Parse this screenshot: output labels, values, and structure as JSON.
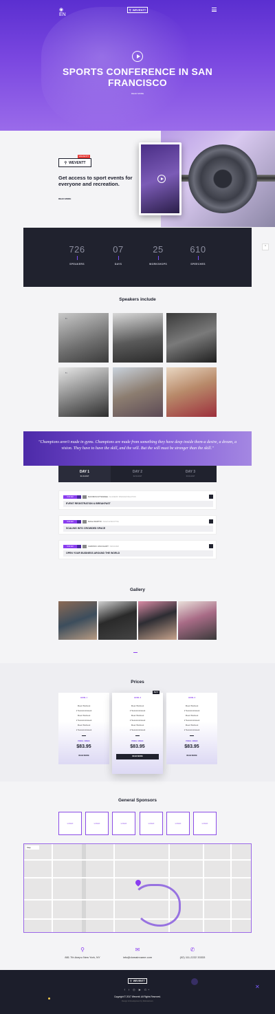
{
  "hero": {
    "title": "SPORTS CONFERENCE IN SAN FRANCISCO",
    "button": "READ MORE",
    "lang": "EN"
  },
  "brand": {
    "name": "WEVENTT"
  },
  "about": {
    "badge_name": "WEVENTT",
    "badge_tag": "WEVENTT",
    "title": "Get access to sport events for everyone and recreation.",
    "button": "READ MORE"
  },
  "counters": [
    {
      "num": "726",
      "label": "SPEAKERS"
    },
    {
      "num": "07",
      "label": "DAYS"
    },
    {
      "num": "25",
      "label": "WORKSHOPS"
    },
    {
      "num": "610",
      "label": "SPEECHES"
    }
  ],
  "speakers": {
    "title": "Speakers include"
  },
  "quote": "\"Champions aren't made in gyms. Champions are made from something they have deep inside them-a desire, a dream, a vision. They have to have the skill, and the will. But the will must be stronger than the skill.\"",
  "schedule": {
    "tabs": [
      {
        "label": "DAY 1",
        "date": "01.01.2017"
      },
      {
        "label": "DAY 2",
        "date": "02.01.2017"
      },
      {
        "label": "DAY 3",
        "date": "03.01.2017"
      }
    ],
    "events": [
      {
        "time": "9:00 AM",
        "name": "MAXIMUM ATTENDEE",
        "role": "/ ACADEMIC SPEAKER RELATION",
        "title": "EVENT REGISTRATION & BREAKFAST"
      },
      {
        "time": "9:00 AM",
        "name": "MAGA MARTIN",
        "role": "/ SALES EXECUTIVE",
        "title": "SCALING INTO CROWDED SPACE"
      },
      {
        "time": "9:00 AM",
        "name": "CHRONIC LINUCHART",
        "role": "/ DESIGNER",
        "title": "OPEN YOUR BUSINESS AROUND THE WORLD"
      }
    ]
  },
  "gallery": {
    "title": "Gallery"
  },
  "prices": {
    "title": "Prices",
    "best_label": "BEST",
    "cards": [
      {
        "plan": "LEVEL 1",
        "features": [
          "Fleet Workout",
          "2 Sessions/week",
          "Fleet Workout",
          "2 Sessions/week",
          "Fleet Workout",
          "2 Sessions/week"
        ],
        "per": "PRICE / WEEK",
        "price": "$83.95",
        "button": "READ MORE"
      },
      {
        "plan": "LEVEL 2",
        "features": [
          "Fleet Workout",
          "2 Sessions/week",
          "Fleet Workout",
          "2 Sessions/week",
          "Fleet Workout",
          "2 Sessions/week"
        ],
        "per": "PRICE / WEEK",
        "price": "$83.95",
        "button": "READ MORE"
      },
      {
        "plan": "LEVEL 3",
        "features": [
          "Fleet Workout",
          "2 Sessions/week",
          "Fleet Workout",
          "2 Sessions/week",
          "Fleet Workout",
          "2 Sessions/week"
        ],
        "per": "PRICE / WEEK",
        "price": "$83.95",
        "button": "READ MORE"
      }
    ]
  },
  "sponsors": {
    "title": "General Sponsors",
    "items": [
      "LOGO",
      "LOGO",
      "LOGO",
      "LOGO",
      "LOGO",
      "LOGO"
    ]
  },
  "map": {
    "type_label": "Map"
  },
  "contact": {
    "address": "881 7th Avepu New York, NY",
    "email": "info@domainname.com",
    "phone": "(02) 111-2222 33333"
  },
  "footer": {
    "brand": "WEVENTT",
    "social": "f t ◎ ▶ G+",
    "copyright": "Copyright © 2017 Weventt. All Rights Reserved.",
    "design": "Design & Development by WebsiteGuru"
  },
  "colors": {
    "accent": "#8a3df0",
    "dark": "#20222e",
    "hero": "#5b2fd0"
  }
}
